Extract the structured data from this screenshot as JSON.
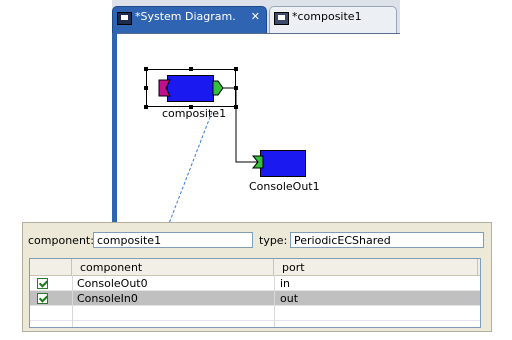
{
  "tabs": [
    {
      "label": "*System Diagram.",
      "close": "✕",
      "icon": "diagram-icon",
      "active": true
    },
    {
      "label": "*composite1",
      "icon": "diagram-icon",
      "active": false
    }
  ],
  "diagram": {
    "components": [
      {
        "name": "composite1",
        "selected": true
      },
      {
        "name": "ConsoleOut1",
        "selected": false
      }
    ]
  },
  "properties": {
    "component_label": "component:",
    "component_value": "composite1",
    "type_label": "type:",
    "type_value": "PeriodicECShared",
    "table": {
      "columns": [
        "component",
        "port"
      ],
      "rows": [
        {
          "checked": true,
          "component": "ConsoleOut0",
          "port": "in",
          "selected": false
        },
        {
          "checked": true,
          "component": "ConsoleIn0",
          "port": "out",
          "selected": true
        }
      ]
    }
  },
  "colors": {
    "component_fill": "#1919f0",
    "tab_active": "#2f64b3",
    "dashed_arrow": "#3a7bd5"
  }
}
